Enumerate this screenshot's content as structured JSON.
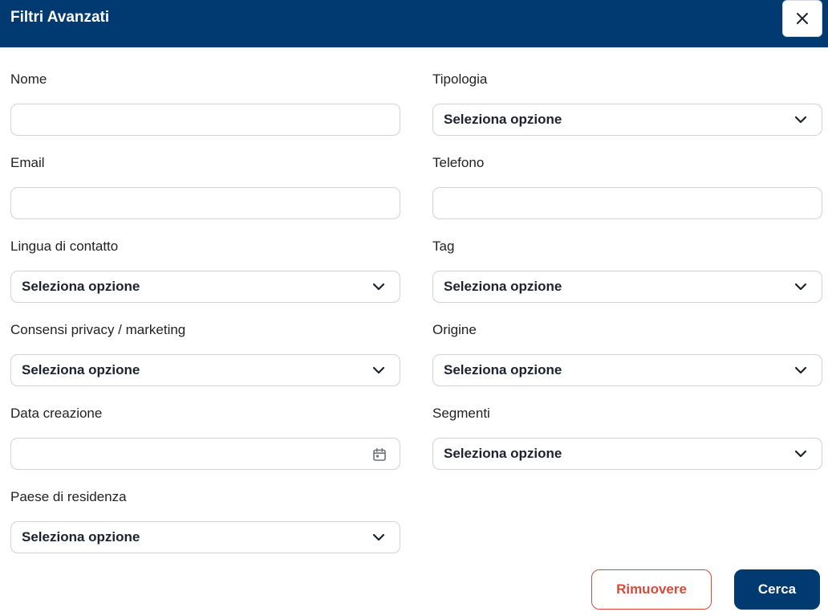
{
  "header": {
    "title": "Filtri Avanzati"
  },
  "fields": {
    "nome": {
      "label": "Nome",
      "value": ""
    },
    "tipologia": {
      "label": "Tipologia",
      "value": "Seleziona opzione"
    },
    "email": {
      "label": "Email",
      "value": ""
    },
    "telefono": {
      "label": "Telefono",
      "value": ""
    },
    "lingua": {
      "label": "Lingua di contatto",
      "value": "Seleziona opzione"
    },
    "tag": {
      "label": "Tag",
      "value": "Seleziona opzione"
    },
    "consensi": {
      "label": "Consensi privacy / marketing",
      "value": "Seleziona opzione"
    },
    "origine": {
      "label": "Origine",
      "value": "Seleziona opzione"
    },
    "data_creazione": {
      "label": "Data creazione",
      "value": ""
    },
    "segmenti": {
      "label": "Segmenti",
      "value": "Seleziona opzione"
    },
    "paese": {
      "label": "Paese di residenza",
      "value": "Seleziona opzione"
    }
  },
  "buttons": {
    "remove": "Rimuovere",
    "search": "Cerca"
  },
  "icons": {
    "close": "close-icon",
    "chevron": "chevron-down-icon",
    "calendar": "calendar-icon"
  },
  "colors": {
    "primary": "#003a70",
    "danger": "#d94a3a",
    "border": "#cfd3d8"
  }
}
